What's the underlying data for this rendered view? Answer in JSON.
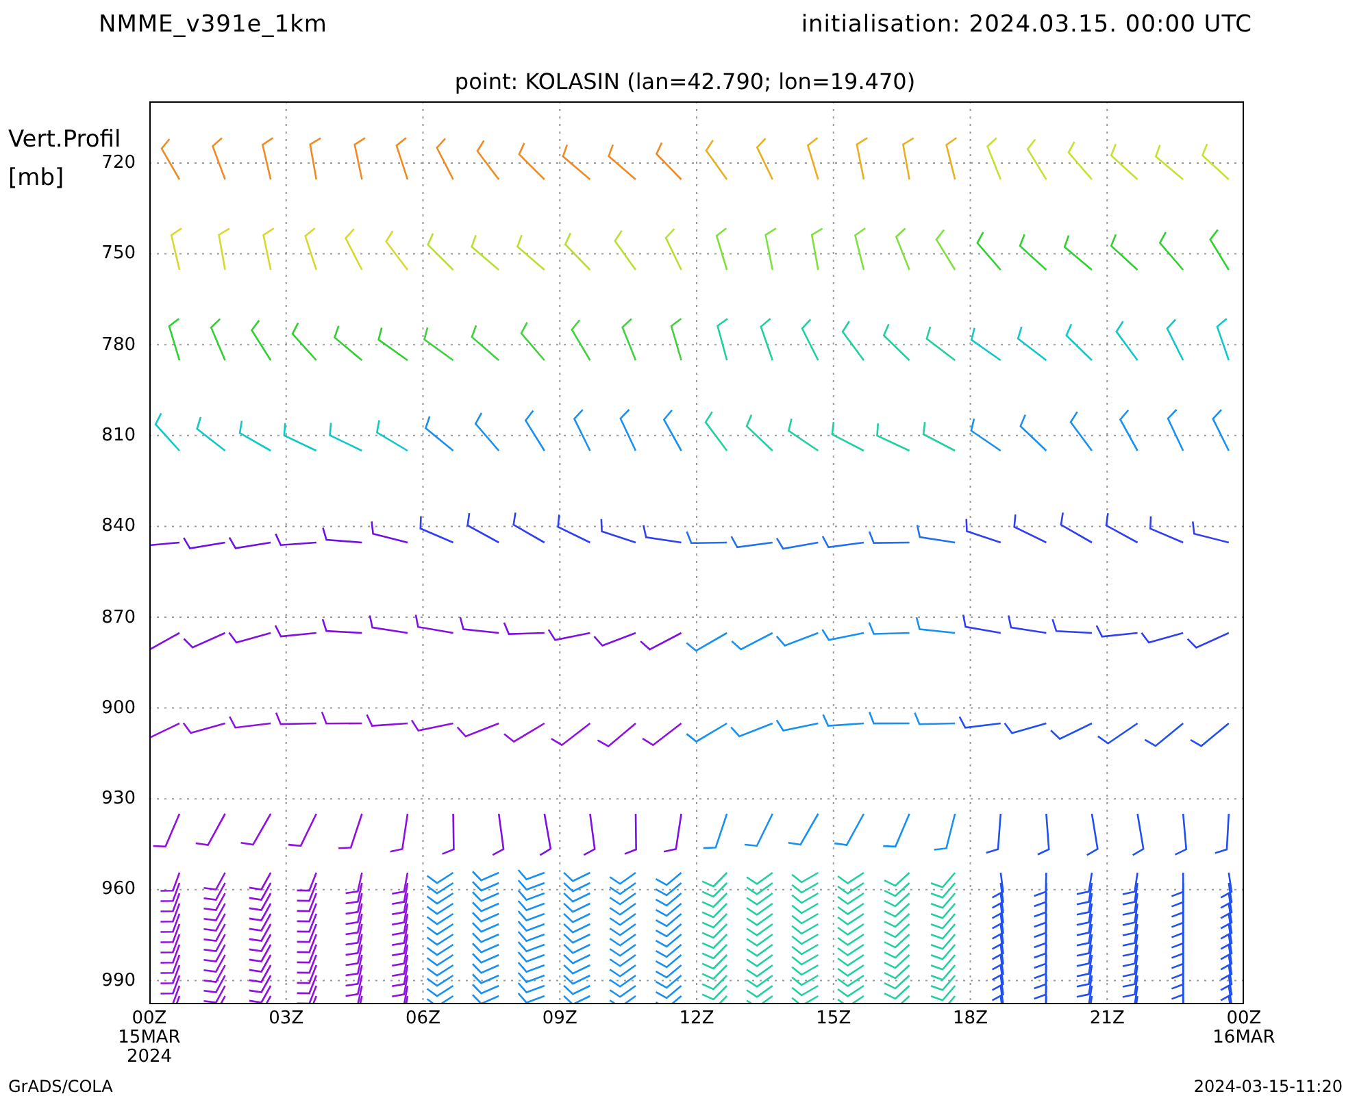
{
  "header": {
    "model": "NMME_v391e_1km",
    "initialisation": "initialisation: 2024.03.15. 00:00 UTC"
  },
  "subtitle": "point: KOLASIN (lan=42.790; lon=19.470)",
  "y_axis": {
    "title": "Vert.Profil",
    "unit": "[mb]",
    "ticks": [
      "720",
      "750",
      "780",
      "810",
      "840",
      "870",
      "900",
      "930",
      "960",
      "990"
    ]
  },
  "x_axis": {
    "ticks": [
      {
        "label": "00Z",
        "date": "15MAR",
        "year": "2024"
      },
      {
        "label": "03Z"
      },
      {
        "label": "06Z"
      },
      {
        "label": "09Z"
      },
      {
        "label": "12Z"
      },
      {
        "label": "15Z"
      },
      {
        "label": "18Z"
      },
      {
        "label": "21Z"
      },
      {
        "label": "00Z",
        "date": "16MAR"
      }
    ]
  },
  "footer": {
    "left": "GrADS/COLA",
    "right": "2024-03-15-11:20"
  }
}
